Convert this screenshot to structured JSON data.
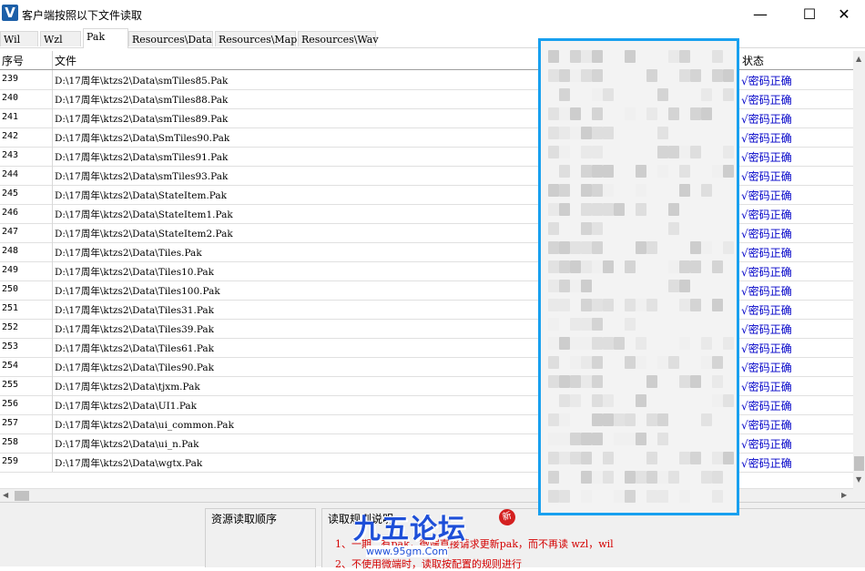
{
  "window": {
    "title": "客户端按照以下文件读取",
    "app_icon_glyph": "V",
    "minimize_glyph": "—",
    "maximize_glyph": "☐",
    "close_glyph": "✕"
  },
  "tabs": [
    {
      "label": "Wil",
      "active": false
    },
    {
      "label": "Wzl",
      "active": false
    },
    {
      "label": "Pak",
      "active": true
    },
    {
      "label": "Resources\\Data",
      "active": false
    },
    {
      "label": "Resources\\Map",
      "active": false
    },
    {
      "label": "Resources\\Wav",
      "active": false
    }
  ],
  "table": {
    "headers": {
      "num": "序号",
      "file": "文件",
      "status": "状态"
    },
    "rows": [
      {
        "num": "239",
        "file": "D:\\17周年\\ktzs2\\Data\\smTiles85.Pak",
        "status": "√密码正确"
      },
      {
        "num": "240",
        "file": "D:\\17周年\\ktzs2\\Data\\smTiles88.Pak",
        "status": "√密码正确"
      },
      {
        "num": "241",
        "file": "D:\\17周年\\ktzs2\\Data\\smTiles89.Pak",
        "status": "√密码正确"
      },
      {
        "num": "242",
        "file": "D:\\17周年\\ktzs2\\Data\\SmTiles90.Pak",
        "status": "√密码正确"
      },
      {
        "num": "243",
        "file": "D:\\17周年\\ktzs2\\Data\\smTiles91.Pak",
        "status": "√密码正确"
      },
      {
        "num": "244",
        "file": "D:\\17周年\\ktzs2\\Data\\smTiles93.Pak",
        "status": "√密码正确"
      },
      {
        "num": "245",
        "file": "D:\\17周年\\ktzs2\\Data\\StateItem.Pak",
        "status": "√密码正确"
      },
      {
        "num": "246",
        "file": "D:\\17周年\\ktzs2\\Data\\StateItem1.Pak",
        "status": "√密码正确"
      },
      {
        "num": "247",
        "file": "D:\\17周年\\ktzs2\\Data\\StateItem2.Pak",
        "status": "√密码正确"
      },
      {
        "num": "248",
        "file": "D:\\17周年\\ktzs2\\Data\\Tiles.Pak",
        "status": "√密码正确"
      },
      {
        "num": "249",
        "file": "D:\\17周年\\ktzs2\\Data\\Tiles10.Pak",
        "status": "√密码正确"
      },
      {
        "num": "250",
        "file": "D:\\17周年\\ktzs2\\Data\\Tiles100.Pak",
        "status": "√密码正确"
      },
      {
        "num": "251",
        "file": "D:\\17周年\\ktzs2\\Data\\Tiles31.Pak",
        "status": "√密码正确"
      },
      {
        "num": "252",
        "file": "D:\\17周年\\ktzs2\\Data\\Tiles39.Pak",
        "status": "√密码正确"
      },
      {
        "num": "253",
        "file": "D:\\17周年\\ktzs2\\Data\\Tiles61.Pak",
        "status": "√密码正确"
      },
      {
        "num": "254",
        "file": "D:\\17周年\\ktzs2\\Data\\Tiles90.Pak",
        "status": "√密码正确"
      },
      {
        "num": "255",
        "file": "D:\\17周年\\ktzs2\\Data\\tjxm.Pak",
        "status": "√密码正确"
      },
      {
        "num": "256",
        "file": "D:\\17周年\\ktzs2\\Data\\UI1.Pak",
        "status": "√密码正确"
      },
      {
        "num": "257",
        "file": "D:\\17周年\\ktzs2\\Data\\ui_common.Pak",
        "status": "√密码正确"
      },
      {
        "num": "258",
        "file": "D:\\17周年\\ktzs2\\Data\\ui_n.Pak",
        "status": "√密码正确"
      },
      {
        "num": "259",
        "file": "D:\\17周年\\ktzs2\\Data\\wgtx.Pak",
        "status": "√密码正确"
      }
    ]
  },
  "bottom": {
    "load_order_label": "资源读取顺序",
    "rules_label": "读取规则说明",
    "rule1": "1、一期...有pak，微端直接请求更新pak，而不再读 wzl，wil",
    "rule2": "2、不使用微端时，读取按配置的规则进行"
  },
  "watermark": {
    "title": "九五论坛",
    "url": "www.95gm.Com",
    "badge": "新"
  },
  "colors": {
    "status_text": "#0000c8",
    "rule_text": "#d40000",
    "highlight_border": "#18a0ef"
  }
}
